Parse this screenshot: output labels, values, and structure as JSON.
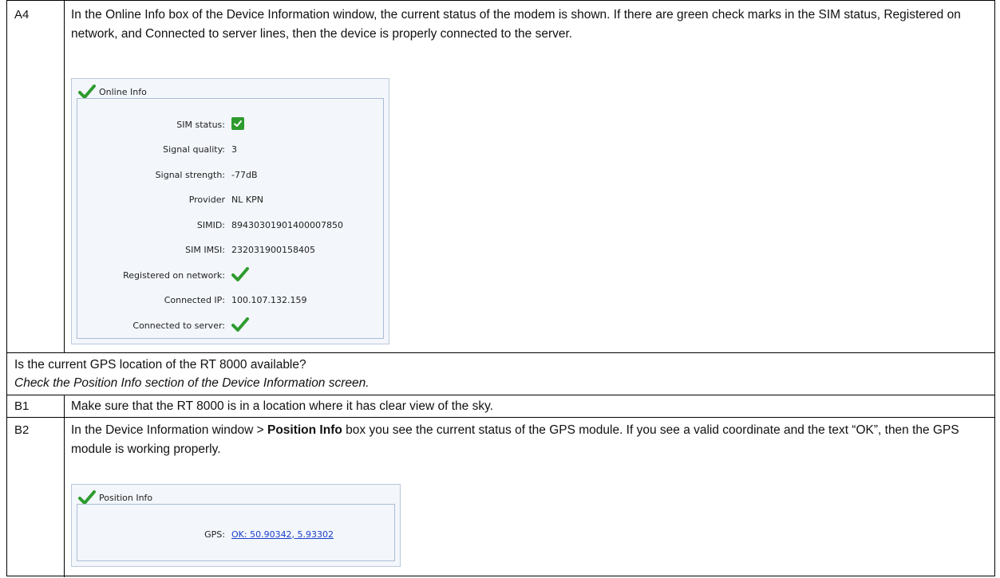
{
  "rows": {
    "a4": {
      "id": "A4",
      "text": "In the Online Info box of the Device Information window, the current status of the modem is shown. If there are green check marks in the SIM status, Registered on network, and Connected to server lines, then the device is properly connected to the server."
    },
    "question": {
      "text": "Is the current GPS location of the RT 8000 available?",
      "hint": "Check the Position Info section of the Device Information screen."
    },
    "b1": {
      "id": "B1",
      "text": "Make sure that the RT 8000 is in a location where it has clear view of the sky."
    },
    "b2": {
      "id": "B2",
      "text_before": "In the Device Information window > ",
      "text_bold": "Position Info",
      "text_after": " box you see the current status of the GPS module. If you see a valid coordinate and the text “OK”, then the GPS module is working properly."
    }
  },
  "online_info": {
    "title": "Online Info",
    "fields": [
      {
        "label": "SIM status:",
        "value": "",
        "icon": "check-box-icon"
      },
      {
        "label": "Signal quality:",
        "value": "3"
      },
      {
        "label": "Signal strength:",
        "value": "-77dB"
      },
      {
        "label": "Provider",
        "value": "NL KPN"
      },
      {
        "label": "SIMID:",
        "value": "89430301901400007850"
      },
      {
        "label": "SIM IMSI:",
        "value": "232031900158405"
      },
      {
        "label": "Registered on network:",
        "value": "",
        "icon": "check-icon"
      },
      {
        "label": "Connected IP:",
        "value": "100.107.132.159"
      },
      {
        "label": "Connected to server:",
        "value": "",
        "icon": "check-icon"
      }
    ]
  },
  "position_info": {
    "title": "Position Info",
    "gps_label": "GPS:",
    "gps_value": "OK: 50.90342, 5.93302"
  },
  "colors": {
    "check_green": "#2e9b2e",
    "link_blue": "#1a3fc9",
    "box_border": "#aabdd4"
  }
}
